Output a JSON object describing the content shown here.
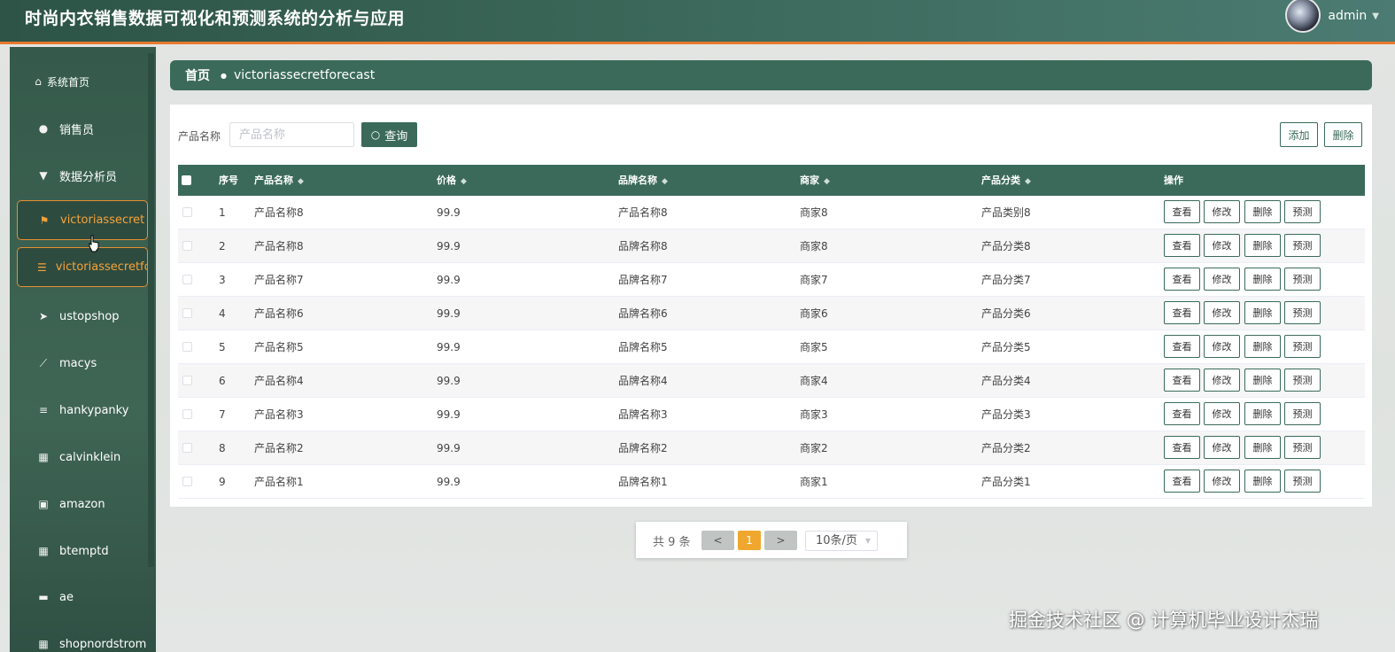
{
  "header": {
    "title": "时尚内衣销售数据可视化和预测系统的分析与应用",
    "username": "admin"
  },
  "sidebar": {
    "items": [
      {
        "label": "系统首页",
        "icon": "home-icon"
      },
      {
        "label": "销售员",
        "icon": "user-icon"
      },
      {
        "label": "数据分析员",
        "icon": "user-tie-icon"
      },
      {
        "label": "victoriassecret",
        "icon": "flag-icon"
      },
      {
        "label": "victoriassecretfor",
        "icon": "list-icon"
      },
      {
        "label": "ustopshop",
        "icon": "paper-plane-icon"
      },
      {
        "label": "macys",
        "icon": "line-chart-icon"
      },
      {
        "label": "hankypanky",
        "icon": "menu-lines-icon"
      },
      {
        "label": "calvinklein",
        "icon": "grid-icon"
      },
      {
        "label": "amazon",
        "icon": "clipboard-icon"
      },
      {
        "label": "btemptd",
        "icon": "grid-icon"
      },
      {
        "label": "ae",
        "icon": "ticket-icon"
      },
      {
        "label": "shopnordstrom",
        "icon": "grid-icon"
      }
    ]
  },
  "breadcrumb": {
    "home": "首页",
    "current": "victoriassecretforecast"
  },
  "search": {
    "label": "产品名称",
    "placeholder": "产品名称",
    "button": "查询"
  },
  "toolbar": {
    "add": "添加",
    "delete": "删除"
  },
  "table": {
    "columns": [
      "序号",
      "产品名称",
      "价格",
      "品牌名称",
      "商家",
      "产品分类",
      "操作"
    ],
    "rows": [
      {
        "no": "1",
        "product": "产品名称8",
        "price": "99.9",
        "brand": "产品名称8",
        "merchant": "商家8",
        "category": "产品类别8"
      },
      {
        "no": "2",
        "product": "产品名称8",
        "price": "99.9",
        "brand": "品牌名称8",
        "merchant": "商家8",
        "category": "产品分类8"
      },
      {
        "no": "3",
        "product": "产品名称7",
        "price": "99.9",
        "brand": "品牌名称7",
        "merchant": "商家7",
        "category": "产品分类7"
      },
      {
        "no": "4",
        "product": "产品名称6",
        "price": "99.9",
        "brand": "品牌名称6",
        "merchant": "商家6",
        "category": "产品分类6"
      },
      {
        "no": "5",
        "product": "产品名称5",
        "price": "99.9",
        "brand": "品牌名称5",
        "merchant": "商家5",
        "category": "产品分类5"
      },
      {
        "no": "6",
        "product": "产品名称4",
        "price": "99.9",
        "brand": "品牌名称4",
        "merchant": "商家4",
        "category": "产品分类4"
      },
      {
        "no": "7",
        "product": "产品名称3",
        "price": "99.9",
        "brand": "品牌名称3",
        "merchant": "商家3",
        "category": "产品分类3"
      },
      {
        "no": "8",
        "product": "产品名称2",
        "price": "99.9",
        "brand": "品牌名称2",
        "merchant": "商家2",
        "category": "产品分类2"
      },
      {
        "no": "9",
        "product": "产品名称1",
        "price": "99.9",
        "brand": "品牌名称1",
        "merchant": "商家1",
        "category": "产品分类1"
      }
    ],
    "actions": [
      "查看",
      "修改",
      "删除",
      "预测"
    ]
  },
  "pagination": {
    "total": "共 9 条",
    "prev": "<",
    "current": "1",
    "next": ">",
    "page_size": "10条/页"
  },
  "watermark": "掘金技术社区 @ 计算机毕业设计杰瑞",
  "colors": {
    "primary": "#3b6a5b",
    "accent": "#f0a72d",
    "header_border": "#e8792e"
  }
}
